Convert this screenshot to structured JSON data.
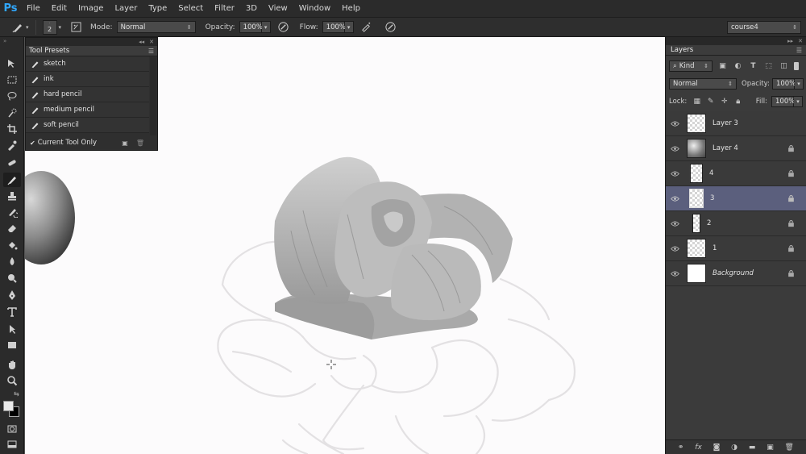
{
  "app": {
    "logo": "Ps"
  },
  "menu": [
    "File",
    "Edit",
    "Image",
    "Layer",
    "Type",
    "Select",
    "Filter",
    "3D",
    "View",
    "Window",
    "Help"
  ],
  "options": {
    "brush_size": "2",
    "mode_label": "Mode:",
    "mode_value": "Normal",
    "opacity_label": "Opacity:",
    "opacity_value": "100%",
    "flow_label": "Flow:",
    "flow_value": "100%",
    "workspace": "course4"
  },
  "tool_presets": {
    "title": "Tool Presets",
    "items": [
      "sketch",
      "ink",
      "hard pencil",
      "medium pencil",
      "soft pencil"
    ],
    "current_tool_only": "Current Tool Only"
  },
  "layers_panel": {
    "title": "Layers",
    "kind_label": "Kind",
    "blend_mode": "Normal",
    "opacity_label": "Opacity:",
    "opacity_value": "100%",
    "lock_label": "Lock:",
    "fill_label": "Fill:",
    "fill_value": "100%",
    "layers": [
      {
        "name": "Layer 3",
        "locked": false,
        "selected": false
      },
      {
        "name": "Layer 4",
        "locked": true,
        "selected": false
      },
      {
        "name": "4",
        "locked": true,
        "selected": false
      },
      {
        "name": "3",
        "locked": true,
        "selected": true
      },
      {
        "name": "2",
        "locked": true,
        "selected": false
      },
      {
        "name": "1",
        "locked": true,
        "selected": false
      },
      {
        "name": "Background",
        "locked": true,
        "selected": false
      }
    ],
    "bottom_icons": [
      "link-icon",
      "fx-icon",
      "mask-icon",
      "adjustment-icon",
      "group-icon",
      "new-layer-icon",
      "trash-icon"
    ]
  },
  "colors": {
    "ui_dark": "#2b2b2b",
    "panel": "#3b3b3b",
    "selected_layer": "#5b5f7d",
    "canvas": "#fcfbfc",
    "ps_blue": "#31a8ff"
  }
}
